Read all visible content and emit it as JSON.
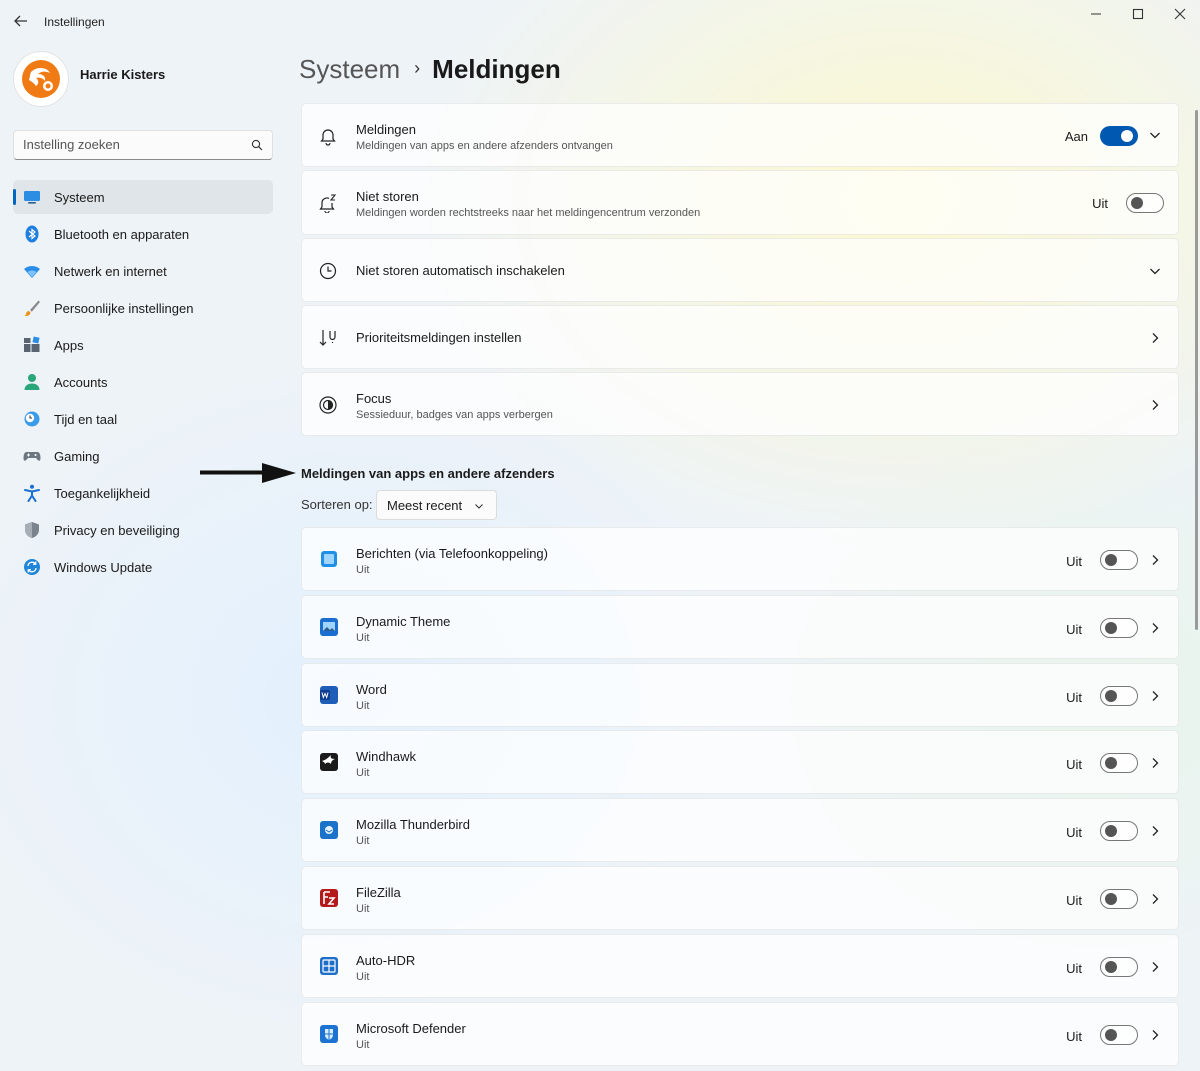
{
  "window": {
    "title": "Instellingen",
    "back_icon": "arrow-left-icon",
    "minimize": "—",
    "maximize": "☐",
    "close": "✕"
  },
  "user": {
    "name": "Harrie Kisters"
  },
  "search": {
    "placeholder": "Instelling zoeken"
  },
  "nav": [
    {
      "label": "Systeem",
      "icon": "monitor-icon",
      "active": true
    },
    {
      "label": "Bluetooth en apparaten",
      "icon": "bluetooth-icon"
    },
    {
      "label": "Netwerk en internet",
      "icon": "wifi-icon"
    },
    {
      "label": "Persoonlijke instellingen",
      "icon": "brush-icon"
    },
    {
      "label": "Apps",
      "icon": "apps-icon"
    },
    {
      "label": "Accounts",
      "icon": "person-icon"
    },
    {
      "label": "Tijd en taal",
      "icon": "globe-clock-icon"
    },
    {
      "label": "Gaming",
      "icon": "gamepad-icon"
    },
    {
      "label": "Toegankelijkheid",
      "icon": "accessibility-icon"
    },
    {
      "label": "Privacy en beveiliging",
      "icon": "shield-icon"
    },
    {
      "label": "Windows Update",
      "icon": "update-icon"
    }
  ],
  "breadcrumb": {
    "parent": "Systeem",
    "separator": "›",
    "current": "Meldingen"
  },
  "settings": {
    "notifications": {
      "title": "Meldingen",
      "subtitle": "Meldingen van apps en andere afzenders ontvangen",
      "state": "Aan",
      "on": true
    },
    "dnd": {
      "title": "Niet storen",
      "subtitle": "Meldingen worden rechtstreeks naar het meldingencentrum verzonden",
      "state": "Uit",
      "on": false
    },
    "dnd_auto": {
      "title": "Niet storen automatisch inschakelen"
    },
    "priority": {
      "title": "Prioriteitsmeldingen instellen"
    },
    "focus": {
      "title": "Focus",
      "subtitle": "Sessieduur, badges van apps verbergen"
    }
  },
  "apps_section": {
    "heading": "Meldingen van apps en andere afzenders",
    "sort_label": "Sorteren op:",
    "sort_value": "Meest recent",
    "apps": [
      {
        "name": "Berichten (via Telefoonkoppeling)",
        "status": "Uit",
        "state": "Uit",
        "on": false,
        "icon": "phone-link-icon",
        "color": "#1e90e8"
      },
      {
        "name": "Dynamic Theme",
        "status": "Uit",
        "state": "Uit",
        "on": false,
        "icon": "dynamic-theme-icon",
        "color": "#1b6fd1"
      },
      {
        "name": "Word",
        "status": "Uit",
        "state": "Uit",
        "on": false,
        "icon": "word-icon",
        "color": "#1e5db8"
      },
      {
        "name": "Windhawk",
        "status": "Uit",
        "state": "Uit",
        "on": false,
        "icon": "windhawk-icon",
        "color": "#1b1b1b"
      },
      {
        "name": "Mozilla Thunderbird",
        "status": "Uit",
        "state": "Uit",
        "on": false,
        "icon": "thunderbird-icon",
        "color": "#1a73c9"
      },
      {
        "name": "FileZilla",
        "status": "Uit",
        "state": "Uit",
        "on": false,
        "icon": "filezilla-icon",
        "color": "#b51a1a"
      },
      {
        "name": "Auto-HDR",
        "status": "Uit",
        "state": "Uit",
        "on": false,
        "icon": "auto-hdr-icon",
        "color": "#1d6fc9"
      },
      {
        "name": "Microsoft Defender",
        "status": "Uit",
        "state": "Uit",
        "on": false,
        "icon": "defender-icon",
        "color": "#1c73d1"
      }
    ]
  }
}
